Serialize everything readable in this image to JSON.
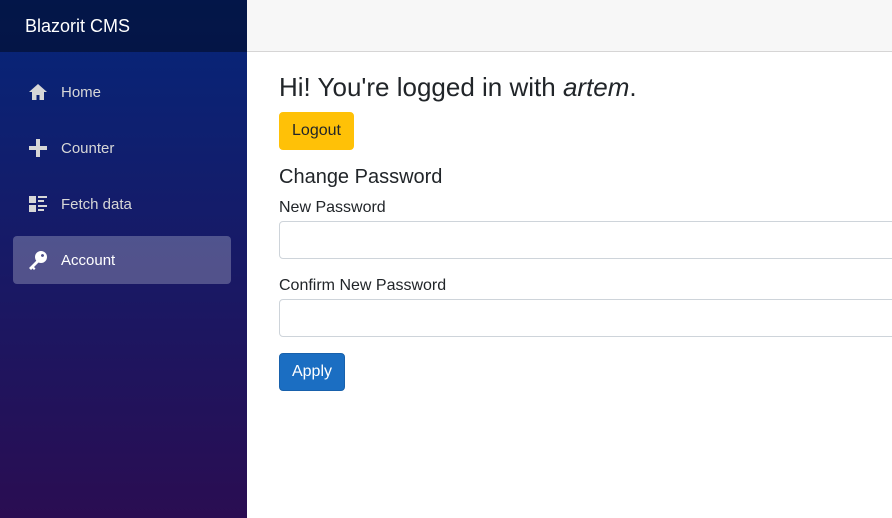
{
  "brand": "Blazorit CMS",
  "nav": [
    {
      "label": "Home",
      "icon": "home-icon",
      "active": false
    },
    {
      "label": "Counter",
      "icon": "plus-icon",
      "active": false
    },
    {
      "label": "Fetch data",
      "icon": "list-rich-icon",
      "active": false
    },
    {
      "label": "Account",
      "icon": "key-icon",
      "active": true
    }
  ],
  "main": {
    "greeting_prefix": "Hi! You're logged in with ",
    "username": "artem",
    "greeting_suffix": ".",
    "logout_label": "Logout",
    "section_title": "Change Password",
    "new_password_label": "New Password",
    "new_password_value": "",
    "confirm_password_label": "Confirm New Password",
    "confirm_password_value": "",
    "apply_label": "Apply"
  },
  "colors": {
    "sidebar_top": "#05267a",
    "sidebar_bottom": "#2a0d52",
    "logout_button": "#ffc107",
    "apply_button": "#1b6ec2"
  }
}
